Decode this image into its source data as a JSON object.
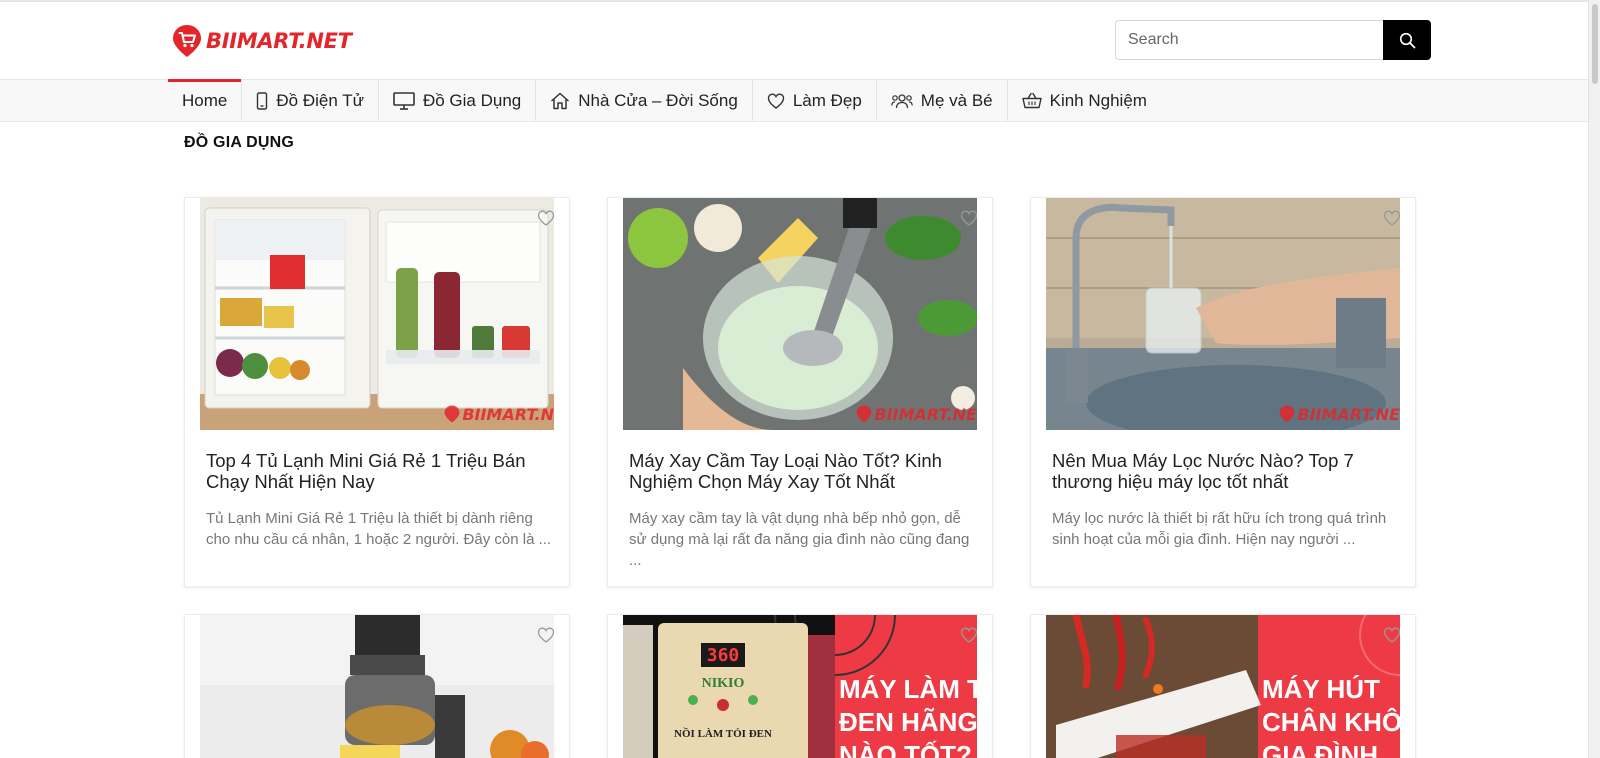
{
  "header": {
    "logo_text": "BIIMART.NET",
    "search_placeholder": "Search"
  },
  "nav": {
    "items": [
      {
        "label": "Home",
        "icon": "none",
        "active": true
      },
      {
        "label": "Đồ Điện Tử",
        "icon": "mobile-phone-icon"
      },
      {
        "label": "Đồ Gia Dụng",
        "icon": "monitor-icon"
      },
      {
        "label": "Nhà Cửa – Đời Sống",
        "icon": "home-icon"
      },
      {
        "label": "Làm Đẹp",
        "icon": "heart-icon"
      },
      {
        "label": "Mẹ và Bé",
        "icon": "users-icon"
      },
      {
        "label": "Kinh Nghiệm",
        "icon": "basket-icon"
      }
    ]
  },
  "section": {
    "title": "ĐỒ GIA DỤNG"
  },
  "posts": [
    {
      "title": "Top 4 Tủ Lạnh Mini Giá Rẻ 1 Triệu Bán Chạy Nhất Hiện Nay",
      "excerpt": "Tủ Lạnh Mini Giá Rẻ 1 Triệu là thiết bị dành riêng cho nhu cầu cá nhân, 1 hoặc 2 người. Đây còn là ...",
      "watermark": "BIIMART.N",
      "image": "mini-fridge-photo"
    },
    {
      "title": "Máy Xay Cầm Tay Loại Nào Tốt? Kinh Nghiệm Chọn Máy Xay Tốt Nhất",
      "excerpt": "Máy xay cầm tay là vật dụng nhà bếp nhỏ gọn, dễ sử dụng mà lại rất đa năng gia đình nào cũng đang ...",
      "watermark": "BIIMART.NE",
      "image": "hand-blender-photo"
    },
    {
      "title": "Nên Mua Máy Lọc Nước Nào? Top 7 thương hiệu máy lọc tốt nhất",
      "excerpt": "Máy lọc nước là thiết bị rất hữu ích trong quá trình sinh hoạt của mỗi gia đình. Hiện nay người ...",
      "watermark": "BIIMART.NE",
      "image": "water-filter-tap-photo"
    },
    {
      "image": "juicer-photo"
    },
    {
      "image": "rice-cooker-promo",
      "display_digits": "360",
      "brand": "NIKIO",
      "product_label": "NỒI LÀM TỎI ĐEN",
      "promo_lines": [
        "MÁY LÀM TỎ",
        "ĐEN HÃNG",
        "NÀO TỐT?"
      ]
    },
    {
      "image": "vacuum-sealer-promo",
      "promo_lines": [
        "MÁY HÚT",
        "CHÂN KHÔN",
        "GIA ĐÌNH"
      ]
    }
  ],
  "colors": {
    "brand_red": "#e3262b",
    "search_button": "#000000",
    "promo_red": "#ee3a44"
  }
}
